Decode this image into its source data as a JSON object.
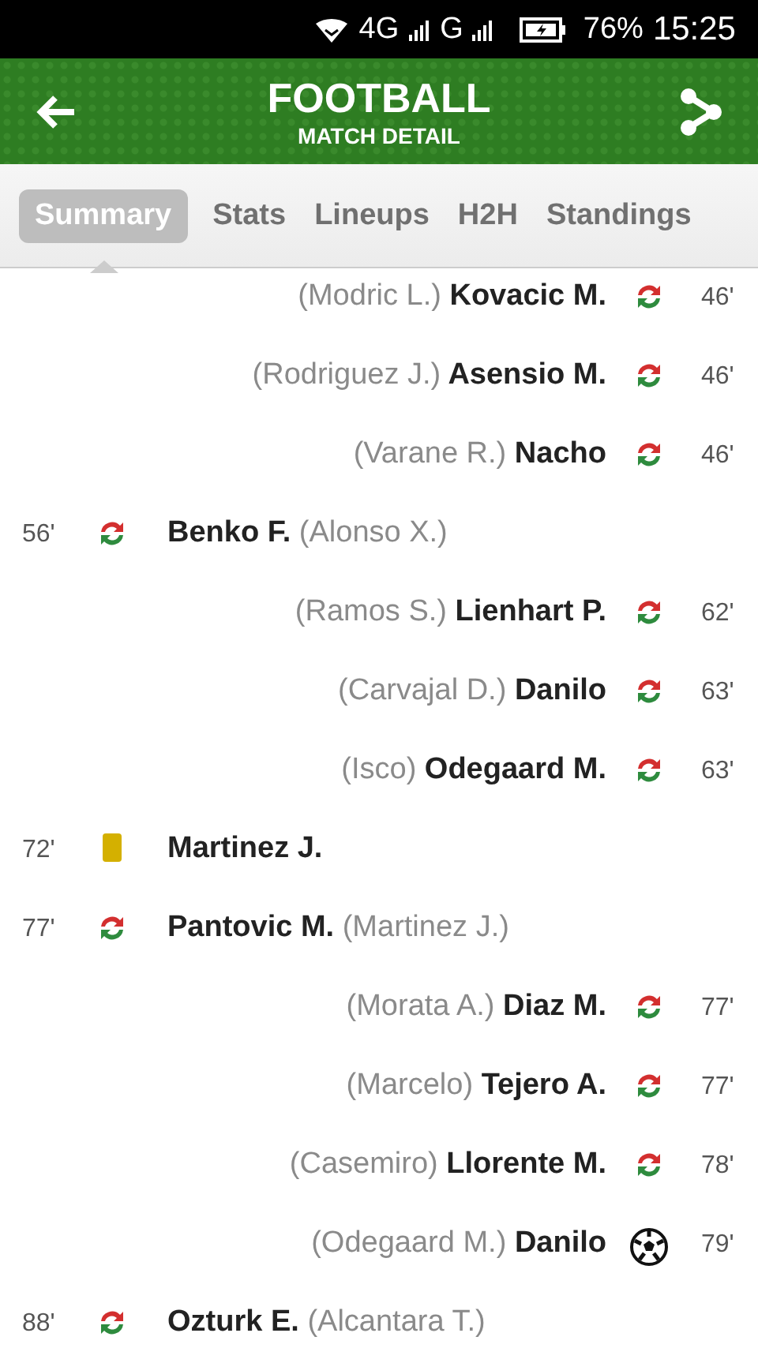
{
  "status_bar": {
    "network_1": "4G",
    "network_2": "G",
    "battery": "76%",
    "time": "15:25"
  },
  "header": {
    "title": "FOOTBALL",
    "subtitle": "MATCH DETAIL"
  },
  "tabs": [
    {
      "label": "Summary",
      "selected": true
    },
    {
      "label": "Stats",
      "selected": false
    },
    {
      "label": "Lineups",
      "selected": false
    },
    {
      "label": "H2H",
      "selected": false
    },
    {
      "label": "Standings",
      "selected": false
    }
  ],
  "events": [
    {
      "away": true,
      "kind": "substitution",
      "minute": "46'",
      "player": "Kovacic M.",
      "other": "(Modric L.)"
    },
    {
      "away": true,
      "kind": "substitution",
      "minute": "46'",
      "player": "Asensio M.",
      "other": "(Rodriguez J.)"
    },
    {
      "away": true,
      "kind": "substitution",
      "minute": "46'",
      "player": "Nacho",
      "other": "(Varane R.)"
    },
    {
      "away": false,
      "kind": "substitution",
      "minute": "56'",
      "player": "Benko F.",
      "other": "(Alonso X.)"
    },
    {
      "away": true,
      "kind": "substitution",
      "minute": "62'",
      "player": "Lienhart P.",
      "other": "(Ramos S.)"
    },
    {
      "away": true,
      "kind": "substitution",
      "minute": "63'",
      "player": "Danilo",
      "other": "(Carvajal D.)"
    },
    {
      "away": true,
      "kind": "substitution",
      "minute": "63'",
      "player": "Odegaard M.",
      "other": "(Isco)"
    },
    {
      "away": false,
      "kind": "yellow_card",
      "minute": "72'",
      "player": "Martinez J."
    },
    {
      "away": false,
      "kind": "substitution",
      "minute": "77'",
      "player": "Pantovic M.",
      "other": "(Martinez J.)"
    },
    {
      "away": true,
      "kind": "substitution",
      "minute": "77'",
      "player": "Diaz M.",
      "other": "(Morata A.)"
    },
    {
      "away": true,
      "kind": "substitution",
      "minute": "77'",
      "player": "Tejero A.",
      "other": "(Marcelo)"
    },
    {
      "away": true,
      "kind": "substitution",
      "minute": "78'",
      "player": "Llorente M.",
      "other": "(Casemiro)"
    },
    {
      "away": true,
      "kind": "goal",
      "minute": "79'",
      "player": "Danilo",
      "other": "(Odegaard M.)"
    },
    {
      "away": false,
      "kind": "substitution",
      "minute": "88'",
      "player": "Ozturk E.",
      "other": "(Alcantara T.)"
    }
  ]
}
